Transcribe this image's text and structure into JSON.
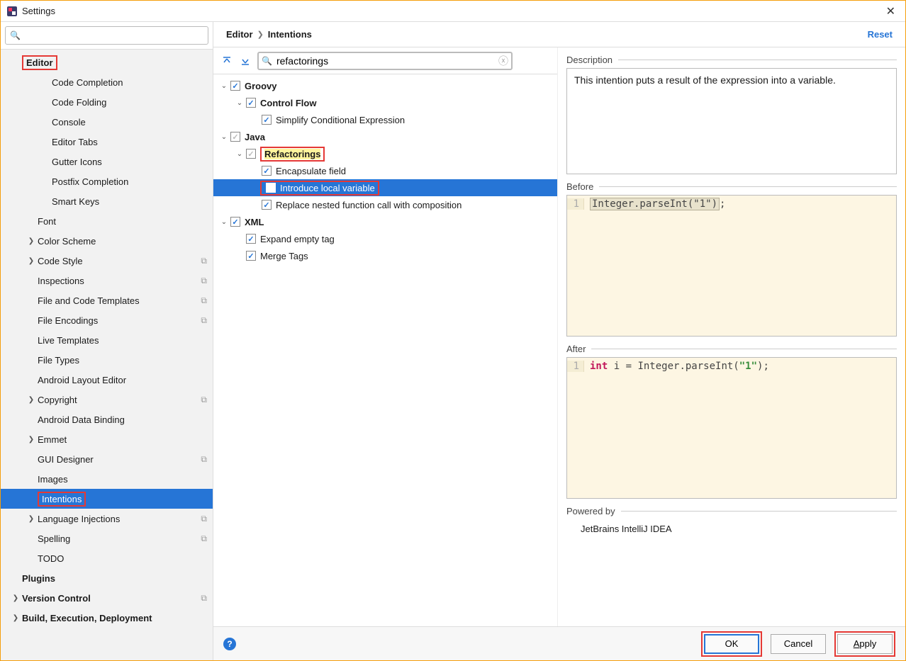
{
  "window": {
    "title": "Settings"
  },
  "sidebar": {
    "search_placeholder": "",
    "items": [
      {
        "label": "Editor",
        "depth": 0,
        "bold": true,
        "exp": "",
        "redbox": true
      },
      {
        "label": "Code Completion",
        "depth": 2
      },
      {
        "label": "Code Folding",
        "depth": 2
      },
      {
        "label": "Console",
        "depth": 2
      },
      {
        "label": "Editor Tabs",
        "depth": 2
      },
      {
        "label": "Gutter Icons",
        "depth": 2
      },
      {
        "label": "Postfix Completion",
        "depth": 2
      },
      {
        "label": "Smart Keys",
        "depth": 2
      },
      {
        "label": "Font",
        "depth": 1
      },
      {
        "label": "Color Scheme",
        "depth": 1,
        "exp": ">"
      },
      {
        "label": "Code Style",
        "depth": 1,
        "exp": ">",
        "copy": true
      },
      {
        "label": "Inspections",
        "depth": 1,
        "copy": true
      },
      {
        "label": "File and Code Templates",
        "depth": 1,
        "copy": true
      },
      {
        "label": "File Encodings",
        "depth": 1,
        "copy": true
      },
      {
        "label": "Live Templates",
        "depth": 1
      },
      {
        "label": "File Types",
        "depth": 1
      },
      {
        "label": "Android Layout Editor",
        "depth": 1
      },
      {
        "label": "Copyright",
        "depth": 1,
        "exp": ">",
        "copy": true
      },
      {
        "label": "Android Data Binding",
        "depth": 1
      },
      {
        "label": "Emmet",
        "depth": 1,
        "exp": ">"
      },
      {
        "label": "GUI Designer",
        "depth": 1,
        "copy": true
      },
      {
        "label": "Images",
        "depth": 1
      },
      {
        "label": "Intentions",
        "depth": 1,
        "selected": true,
        "redbox": true
      },
      {
        "label": "Language Injections",
        "depth": 1,
        "exp": ">",
        "copy": true
      },
      {
        "label": "Spelling",
        "depth": 1,
        "copy": true
      },
      {
        "label": "TODO",
        "depth": 1
      },
      {
        "label": "Plugins",
        "depth": 0,
        "bold": true
      },
      {
        "label": "Version Control",
        "depth": 0,
        "bold": true,
        "exp": ">",
        "copy": true
      },
      {
        "label": "Build, Execution, Deployment",
        "depth": 0,
        "bold": true,
        "exp": ">"
      }
    ]
  },
  "breadcrumb": {
    "a": "Editor",
    "b": "Intentions"
  },
  "reset": "Reset",
  "int_search": {
    "value": "refactorings"
  },
  "intentions": [
    {
      "label": "Groovy",
      "depth": 0,
      "exp": "v",
      "chk": "✓",
      "bold": true
    },
    {
      "label": "Control Flow",
      "depth": 1,
      "exp": "v",
      "chk": "✓",
      "bold": true
    },
    {
      "label": "Simplify Conditional Expression",
      "depth": 2,
      "chk": "✓"
    },
    {
      "label": "Java",
      "depth": 0,
      "exp": "v",
      "chk": "✓",
      "gray": true,
      "bold": true
    },
    {
      "label": "Refactorings",
      "depth": 1,
      "exp": "v",
      "chk": "✓",
      "gray": true,
      "bold": true,
      "hl": true,
      "redbox": true
    },
    {
      "label": "Encapsulate field",
      "depth": 2,
      "chk": "✓"
    },
    {
      "label": "Introduce local variable",
      "depth": 2,
      "chk": "",
      "sel": true,
      "redbox": true
    },
    {
      "label": "Replace nested function call with composition",
      "depth": 2,
      "chk": "✓"
    },
    {
      "label": "XML",
      "depth": 0,
      "exp": "v",
      "chk": "✓",
      "bold": true
    },
    {
      "label": "Expand empty tag",
      "depth": 1,
      "chk": "✓"
    },
    {
      "label": "Merge Tags",
      "depth": 1,
      "chk": "✓"
    }
  ],
  "right": {
    "desc_label": "Description",
    "desc_text": "This intention puts a result of the expression into a variable.",
    "before_label": "Before",
    "after_label": "After",
    "before_code": "Integer.parseInt(\"1\")",
    "after_prefix": "int",
    "after_mid": " i = Integer.parseInt(",
    "after_str": "\"1\"",
    "after_suffix": ");",
    "powered_label": "Powered by",
    "powered_text": "JetBrains IntelliJ IDEA"
  },
  "footer": {
    "ok": "OK",
    "cancel": "Cancel",
    "apply": "Apply"
  }
}
